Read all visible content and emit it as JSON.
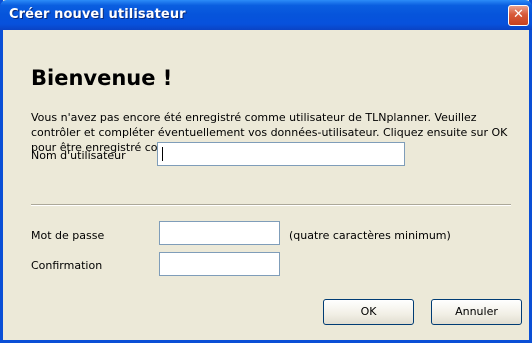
{
  "window": {
    "title": "Créer nouvel utilisateur",
    "close_glyph": "✕"
  },
  "heading": "Bienvenue !",
  "intro": "Vous n'avez pas encore été enregistré comme utilisateur de TLNplanner. Veuillez contrôler et compléter éventuellement vos données-utilisateur. Cliquez ensuite sur OK pour être enregistré comme utilisateur de TLNplanner.",
  "form": {
    "username_label": "Nom d'utilisateur",
    "username_value": "",
    "password_label": "Mot de passe",
    "password_value": "",
    "password_hint": "(quatre caractères minimum)",
    "confirm_label": "Confirmation",
    "confirm_value": ""
  },
  "buttons": {
    "ok": "OK",
    "cancel": "Annuler"
  },
  "colors": {
    "titlebar": "#0654db",
    "frame": "#0a4fd6",
    "client": "#ece9d8",
    "close": "#d85a3a"
  }
}
